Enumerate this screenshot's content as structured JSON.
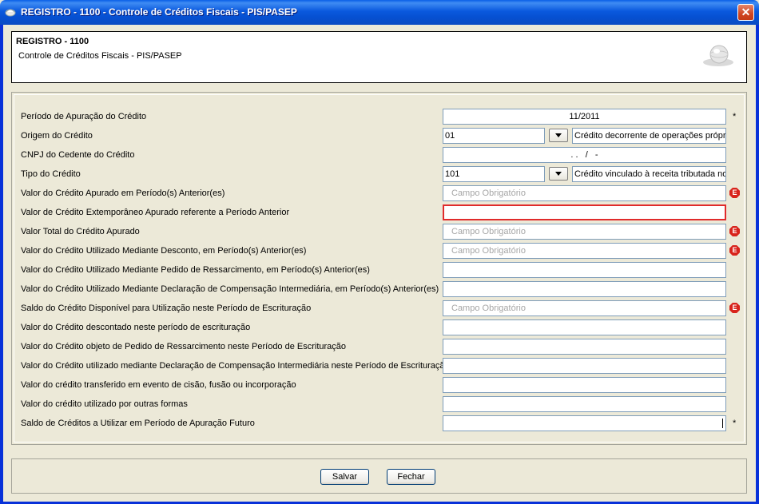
{
  "window": {
    "title": "REGISTRO - 1100 - Controle de Créditos Fiscais - PIS/PASEP",
    "close_label": "✕"
  },
  "header": {
    "title": "REGISTRO - 1100",
    "subtitle": "Controle de Créditos Fiscais - PIS/PASEP"
  },
  "form": {
    "required_marker": "*",
    "required_icon": "E",
    "fields": [
      {
        "label": "Período de Apuração do Crédito",
        "value": "11/2011"
      },
      {
        "label": "Origem do Crédito",
        "code": "01",
        "description": "Crédito decorrente de operações próprias"
      },
      {
        "label": "CNPJ do Cedente do Crédito",
        "value": ". .   /   -"
      },
      {
        "label": "Tipo do Crédito",
        "code": "101",
        "description": "Crédito vinculado à receita tributada no mercado interno"
      },
      {
        "label": "Valor do Crédito Apurado em Período(s) Anterior(es)",
        "placeholder": "Campo Obrigatório"
      },
      {
        "label": "Valor de Crédito Extemporâneo Apurado referente a Período Anterior",
        "value": ""
      },
      {
        "label": "Valor Total do Crédito Apurado",
        "placeholder": "Campo Obrigatório"
      },
      {
        "label": "Valor do Crédito Utilizado Mediante Desconto, em Período(s) Anterior(es)",
        "placeholder": "Campo Obrigatório"
      },
      {
        "label": "Valor do Crédito Utilizado Mediante Pedido de Ressarcimento, em Período(s) Anterior(es)",
        "value": ""
      },
      {
        "label": "Valor do Crédito Utilizado Mediante Declaração de Compensação Intermediária, em Período(s) Anterior(es)",
        "value": ""
      },
      {
        "label": "Saldo do Crédito Disponível para Utilização neste Período de Escrituração",
        "placeholder": "Campo Obrigatório"
      },
      {
        "label": "Valor do Crédito descontado neste período de escrituração",
        "value": ""
      },
      {
        "label": "Valor do Crédito objeto de Pedido de Ressarcimento neste Período de Escrituração",
        "value": ""
      },
      {
        "label": "Valor do Crédito utilizado mediante Declaração de Compensação Intermediária neste Período de Escrituração",
        "value": ""
      },
      {
        "label": "Valor do crédito transferido em evento de cisão, fusão ou incorporação",
        "value": ""
      },
      {
        "label": "Valor do crédito utilizado por outras formas",
        "value": ""
      },
      {
        "label": "Saldo de Créditos a Utilizar em Período de Apuração Futuro",
        "value": ""
      }
    ]
  },
  "buttons": {
    "save_label": "Salvar",
    "close_label": "Fechar"
  },
  "colors": {
    "titlebar": "#0a59de",
    "error_border": "#e02b2b",
    "required_icon": "#d8241c",
    "placeholder_text": "#a6a6a6"
  },
  "icons": [
    "app-icon",
    "close-icon",
    "logo-icon",
    "required-icon",
    "dropdown-arrow-icon"
  ]
}
